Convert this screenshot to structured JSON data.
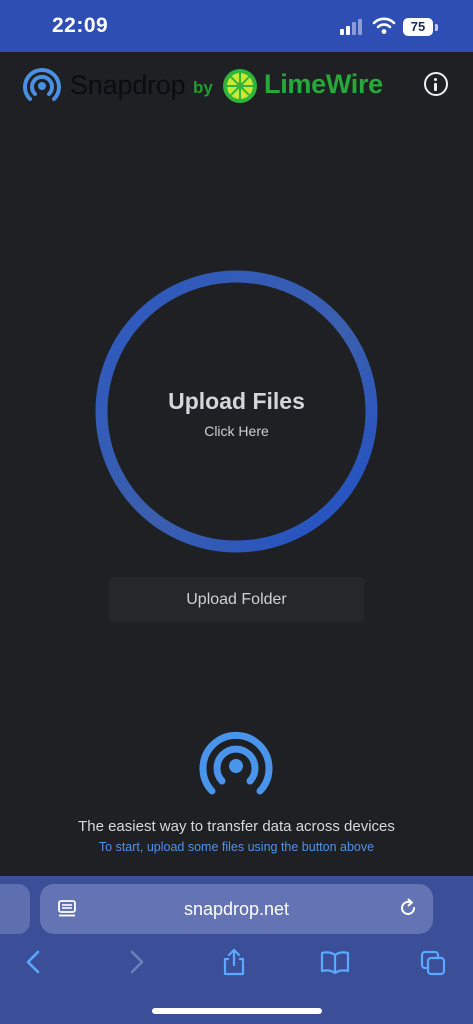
{
  "status_bar": {
    "time": "22:09",
    "battery": "75"
  },
  "header": {
    "brand": "Snapdrop",
    "by": "by",
    "partner": "LimeWire",
    "brand_color": "#4a90e2",
    "partner_color": "#26a83a",
    "icons": [
      "snapdrop-logo-icon",
      "limewire-logo-icon",
      "info-icon"
    ]
  },
  "upload": {
    "title": "Upload Files",
    "subtitle": "Click Here",
    "folder_label": "Upload Folder",
    "ring_color": "#2a5bd0"
  },
  "footer": {
    "tagline": "The easiest way to transfer data across devices",
    "hint": "To start, upload some files using the button above",
    "hint_color": "#4f93e8"
  },
  "browser": {
    "url": "snapdrop.net",
    "icons": [
      "reader-icon",
      "reload-icon",
      "back-icon",
      "forward-icon",
      "share-icon",
      "bookmarks-icon",
      "tabs-icon"
    ]
  }
}
